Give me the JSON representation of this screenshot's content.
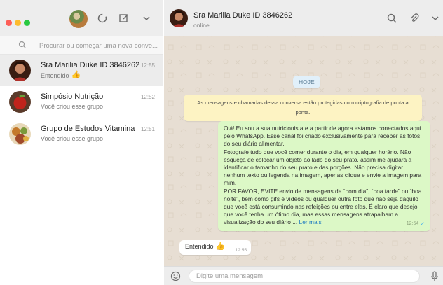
{
  "sidebar": {
    "search": {
      "placeholder": "Procurar ou começar uma nova conve..."
    },
    "chats": [
      {
        "name": "Sra Marilia Duke ID 3846262",
        "time": "12:55",
        "last_message": "Entendido",
        "last_emoji": "👍",
        "active": true
      },
      {
        "name": "Simpósio Nutrição",
        "time": "12:52",
        "last_message": "Você criou esse grupo",
        "active": false
      },
      {
        "name": "Grupo de Estudos Vitamina",
        "time": "12:51",
        "last_message": "Você criou esse grupo",
        "active": false
      }
    ]
  },
  "conversation": {
    "contact_name": "Sra Marilia Duke ID 3846262",
    "contact_status": "online",
    "date_label": "HOJE",
    "encryption_notice": "As mensagens e chamadas dessa conversa estão protegidas com criptografia de ponta a ponta.",
    "messages": [
      {
        "direction": "out",
        "paragraphs": [
          "Olá! Eu sou a sua nutricionista e a partir de agora estamos conectados aqui pelo WhatsApp. Esse canal foi criado exclusivamente para receber as fotos do seu diário alimentar.",
          "Fotografe tudo que você comer durante o dia, em qualquer horário. Não esqueça de colocar um objeto ao lado do seu prato, assim me ajudará a identificar o tamanho do seu prato e das porções. Não precisa digitar nenhum texto ou legenda na imagem, apenas clique e envie a imagem para mim.",
          "POR FAVOR, EVITE envio de mensagens de “bom dia”, “boa tarde” ou “boa noite”, bem como gifs e vídeos ou qualquer outra foto que não seja daquilo que você está consumindo nas refeições ou entre elas. É claro que desejo que você tenha um ótimo dia, mas essas mensagens atrapalham a visualização do seu diário ..."
        ],
        "read_more": "Ler mais",
        "time": "12:54",
        "status": "read"
      },
      {
        "direction": "in",
        "text": "Entendido",
        "emoji": "👍",
        "time": "12:55"
      }
    ],
    "composer_placeholder": "Digite uma mensagem"
  },
  "colors": {
    "outgoing_bubble": "#dcf8c6",
    "incoming_bubble": "#ffffff",
    "notice_bg": "#fdf3c3",
    "date_pill_bg": "#e1f0fa",
    "link": "#1f7bc0",
    "read_tick": "#4fb6ec"
  },
  "icons": [
    "status-icon",
    "new-chat-icon",
    "menu-chevron-icon",
    "search-icon",
    "attach-icon",
    "emoji-icon",
    "mic-icon"
  ]
}
